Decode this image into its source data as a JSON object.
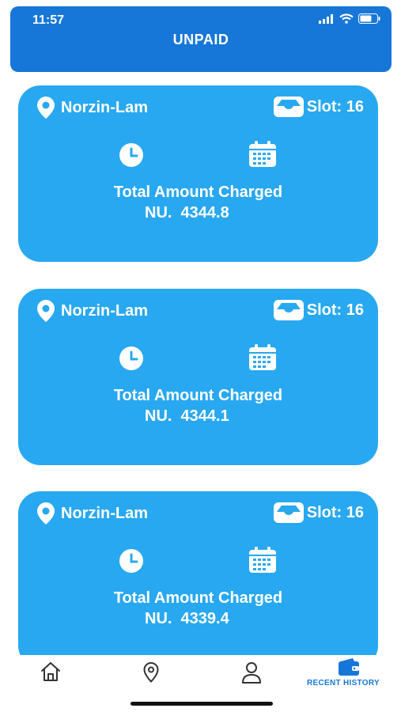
{
  "status_bar": {
    "time": "11:57"
  },
  "header": {
    "title": "UNPAID"
  },
  "cards": [
    {
      "location": "Norzin-Lam",
      "slot": "Slot: 16",
      "amount_label": "Total Amount Charged",
      "amount": "NU.  4344.8"
    },
    {
      "location": "Norzin-Lam",
      "slot": "Slot: 16",
      "amount_label": "Total Amount Charged",
      "amount": "NU.  4344.1"
    },
    {
      "location": "Norzin-Lam",
      "slot": "Slot: 16",
      "amount_label": "Total Amount Charged",
      "amount": "NU.  4339.4"
    }
  ],
  "bottom_nav": {
    "items": [
      {
        "icon": "home-icon"
      },
      {
        "icon": "location-pin-icon"
      },
      {
        "icon": "user-icon"
      },
      {
        "icon": "wallet-icon",
        "label": "RECENT HISTORY",
        "active": true
      }
    ]
  },
  "colors": {
    "header": "#1677d8",
    "card": "#28a8f0",
    "active_nav": "#1677d8"
  }
}
